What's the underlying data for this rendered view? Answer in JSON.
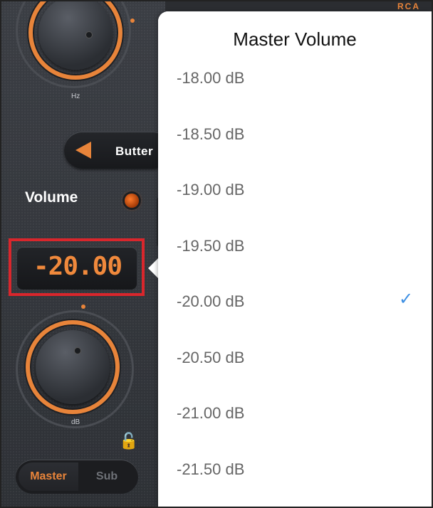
{
  "panel": {
    "top_knob_unit": "Hz",
    "filter_button_label": "Butter",
    "volume_label": "Volume",
    "volume_value": "-20.00",
    "bottom_knob_unit": "dB",
    "mode_tabs": [
      {
        "label": "Master",
        "selected": true
      },
      {
        "label": "Sub",
        "selected": false
      }
    ],
    "corner_label": "RCA",
    "accent_color": "#e8843a",
    "highlight_color": "#d9262c"
  },
  "popover": {
    "title": "Master Volume",
    "options": [
      {
        "label": "-18.00 dB",
        "selected": false
      },
      {
        "label": "-18.50 dB",
        "selected": false
      },
      {
        "label": "-19.00 dB",
        "selected": false
      },
      {
        "label": "-19.50 dB",
        "selected": false
      },
      {
        "label": "-20.00 dB",
        "selected": true
      },
      {
        "label": "-20.50 dB",
        "selected": false
      },
      {
        "label": "-21.00 dB",
        "selected": false
      },
      {
        "label": "-21.50 dB",
        "selected": false
      }
    ],
    "check_color": "#3d8fe3"
  }
}
